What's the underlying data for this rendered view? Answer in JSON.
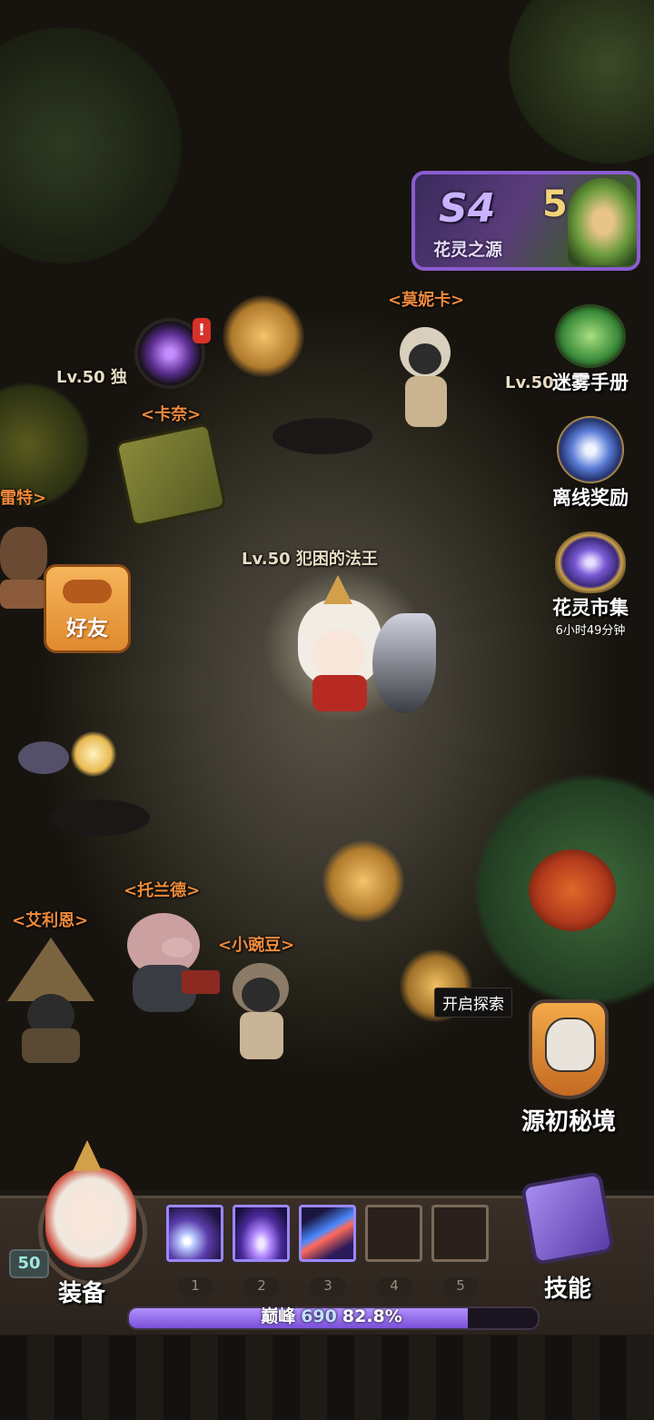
{
  "season_banner": {
    "season": "S4",
    "number": "5",
    "title": "花灵之源"
  },
  "player": {
    "name_tag": "Lv.50 犯困的法王",
    "level_badge": "50"
  },
  "npcs": {
    "monika": "<莫妮卡>",
    "kana": "<卡奈>",
    "reit": "雷特>",
    "toland": "<托兰德>",
    "ellien": "<艾利恩>",
    "pea": "<小豌豆>"
  },
  "other_players": {
    "left_partial": "Lv.50 独",
    "right_partial": "Lv.50"
  },
  "side_menu": {
    "mist_manual": "迷雾手册",
    "offline_reward": "离线奖励",
    "flower_market": "花灵市集",
    "flower_market_timer": "6小时49分钟"
  },
  "friends_button": "好友",
  "explore_tooltip": "开启探索",
  "origin_realm": "源初秘境",
  "bottom_bar": {
    "equip_label": "装备",
    "skills_label": "技能",
    "slot_numbers": [
      "1",
      "2",
      "3",
      "4",
      "5"
    ],
    "rank_label": "巅峰",
    "rank_value": "690",
    "progress_text": "82.8%",
    "progress": 0.828
  },
  "colors": {
    "npc_name": "#f08a3c",
    "player_name": "#e8dcc4",
    "xp_fill": "#9b74f0",
    "friends_button": "#f0a040"
  }
}
